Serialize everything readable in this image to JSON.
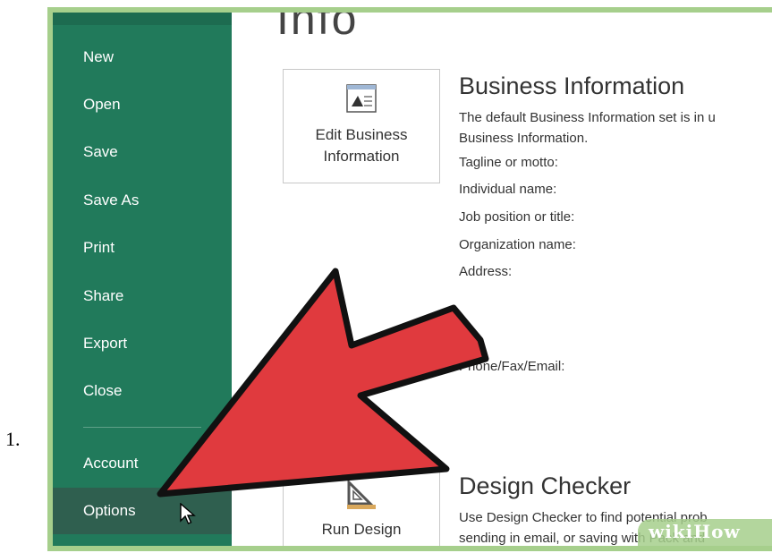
{
  "list_number": "1.",
  "sidebar": {
    "items": [
      {
        "label": "New"
      },
      {
        "label": "Open"
      },
      {
        "label": "Save"
      },
      {
        "label": "Save As"
      },
      {
        "label": "Print"
      },
      {
        "label": "Share"
      },
      {
        "label": "Export"
      },
      {
        "label": "Close"
      }
    ],
    "account_label": "Account",
    "options_label": "Options",
    "selected": "Options"
  },
  "main": {
    "title": "Info",
    "business_info": {
      "button_label_line1": "Edit Business",
      "button_label_line2": "Information",
      "heading": "Business Information",
      "description_line1": "The default Business Information set is in u",
      "description_line2": "Business Information.",
      "fields": [
        "Tagline or motto:",
        "Individual name:",
        "Job position or title:",
        "Organization name:",
        "Address:"
      ],
      "phone_label": "Phone/Fax/Email:"
    },
    "design_checker": {
      "button_label": "Run Design",
      "heading": "Design Checker",
      "description_line1": "Use Design Checker to find potential prob",
      "description_line2": "sending in email, or saving with Pack and"
    }
  },
  "watermark": "wikiHow",
  "colors": {
    "sidebar": "#217a5b",
    "selected_item": "#2f5f4f",
    "frame": "#a6cf8c",
    "arrow": "#e03a3e"
  },
  "icons": {
    "business_card": "picture-card-icon",
    "design_checker": "ruler-triangle-icon",
    "cursor": "mouse-pointer-icon",
    "annotation": "red-arrow"
  }
}
